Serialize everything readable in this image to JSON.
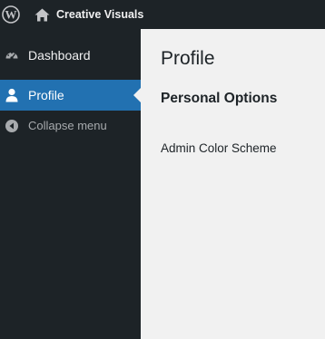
{
  "admin_bar": {
    "logo_icon": "wordpress-logo-icon",
    "home_icon": "home-icon",
    "site_name": "Creative Visuals"
  },
  "sidebar": {
    "items": [
      {
        "label": "Dashboard",
        "icon": "dashboard-gauge-icon",
        "active": false
      },
      {
        "label": "Profile",
        "icon": "user-icon",
        "active": true
      },
      {
        "label": "Collapse menu",
        "icon": "collapse-arrow-icon",
        "active": false
      }
    ]
  },
  "main": {
    "page_title": "Profile",
    "section_heading": "Personal Options",
    "field_label": "Admin Color Scheme"
  },
  "colors": {
    "admin_bar_bg": "#1d2327",
    "sidebar_bg": "#1d2327",
    "active_item_bg": "#2271b1",
    "content_bg": "#f1f1f1",
    "muted_text": "#a7aaad"
  }
}
